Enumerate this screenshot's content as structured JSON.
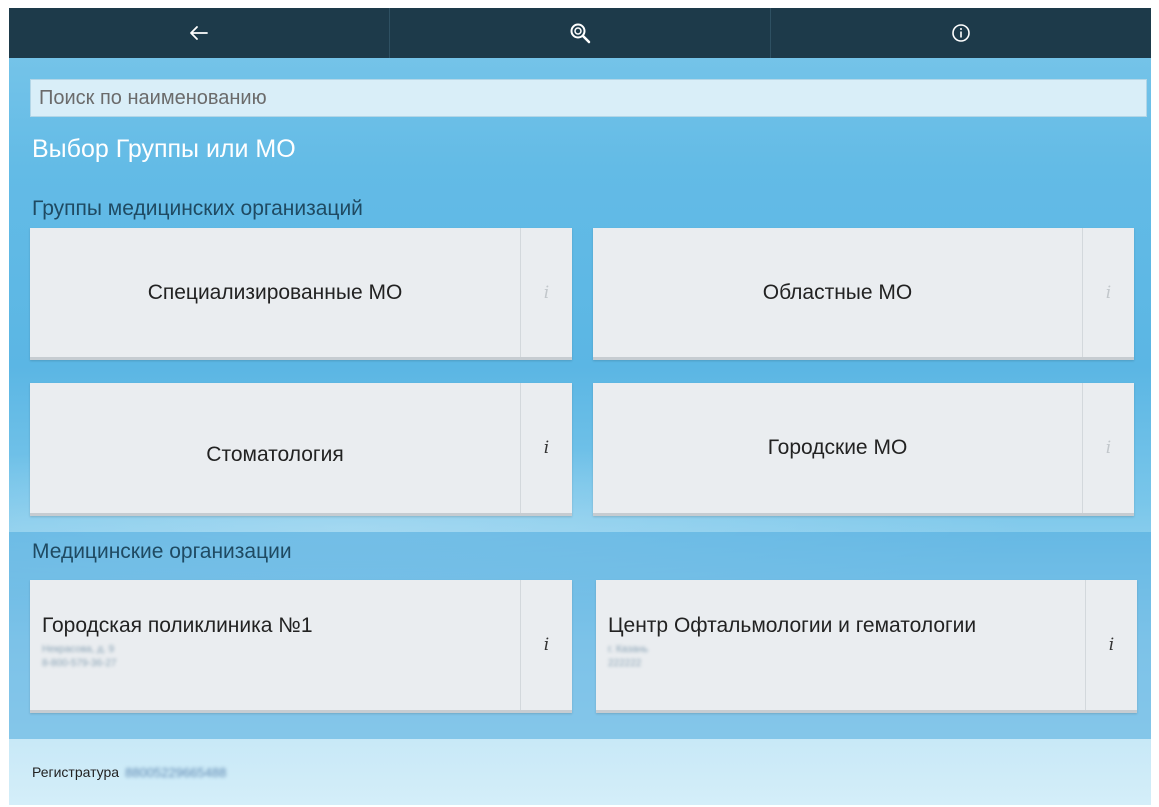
{
  "topbar": {
    "back_icon": "arrow-left-icon",
    "search_icon": "search-icon",
    "info_icon": "info-circle-icon"
  },
  "search": {
    "placeholder": "Поиск по наименованию",
    "value": ""
  },
  "title": "Выбор Группы или МО",
  "groups": {
    "label": "Группы медицинских организаций",
    "items": [
      {
        "name": "Специализированные МО",
        "info": "i",
        "info_active": false
      },
      {
        "name": "Областные МО",
        "info": "i",
        "info_active": false
      },
      {
        "name": "Стоматология",
        "info": "i",
        "info_active": true
      },
      {
        "name": "Городские МО",
        "info": "i",
        "info_active": false
      }
    ]
  },
  "orgs": {
    "label": "Медицинские организации",
    "items": [
      {
        "name": "Городская поликлиника  №1",
        "address": "Некрасова, д. 9",
        "phone": "8-800-579-36-27",
        "info": "i"
      },
      {
        "name": "Центр Офтальмологии и гематологии",
        "address": "г. Казань",
        "phone": "222222",
        "info": "i"
      }
    ]
  },
  "footer": {
    "label": "Регистратура",
    "value": "88005229665488"
  },
  "colors": {
    "topbar": "#1d3a4a",
    "card": "#eaedf0",
    "sky": "#5bb6e4"
  }
}
